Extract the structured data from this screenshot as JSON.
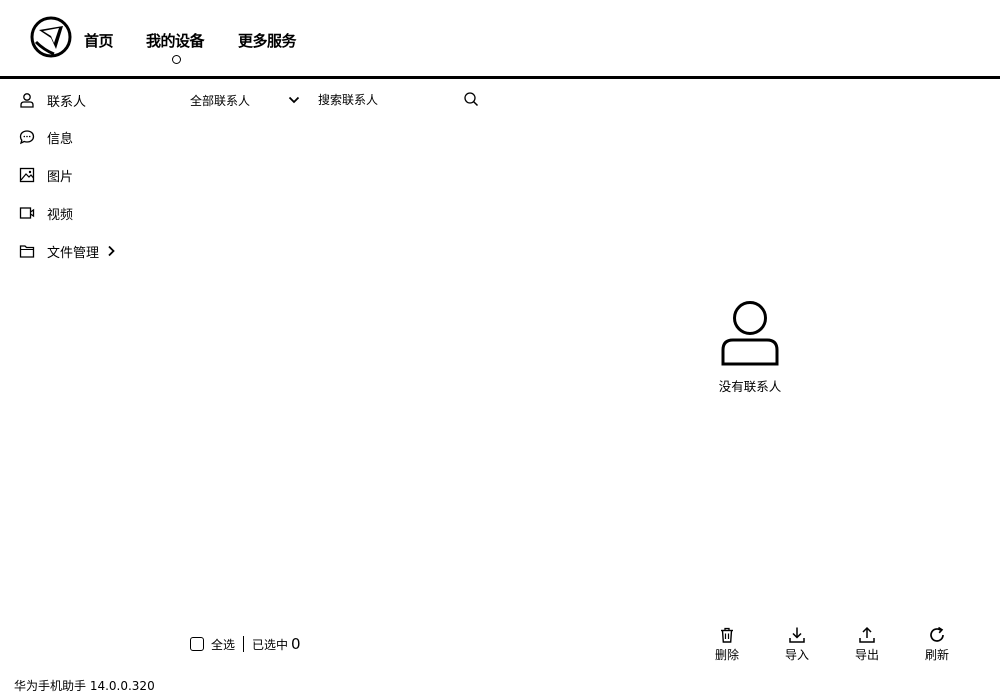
{
  "header": {
    "tabs": [
      {
        "label": "首页"
      },
      {
        "label": "我的设备",
        "active": true
      },
      {
        "label": "更多服务"
      }
    ]
  },
  "sidebar": {
    "items": [
      {
        "label": "联系人",
        "icon": "person-icon"
      },
      {
        "label": "信息",
        "icon": "chat-bubble-icon"
      },
      {
        "label": "图片",
        "icon": "image-icon"
      },
      {
        "label": "视频",
        "icon": "video-icon"
      },
      {
        "label": "文件管理",
        "icon": "folder-icon",
        "has_submenu": true
      }
    ]
  },
  "toolbar": {
    "filter_label": "全部联系人",
    "search_placeholder": "搜索联系人"
  },
  "empty_state": {
    "icon": "person-icon",
    "text": "没有联系人"
  },
  "footer": {
    "select_all_label": "全选",
    "selected_label": "已选中",
    "selected_count": "0",
    "actions": [
      {
        "label": "删除",
        "icon": "trash-icon"
      },
      {
        "label": "导入",
        "icon": "download-icon"
      },
      {
        "label": "导出",
        "icon": "upload-icon"
      },
      {
        "label": "刷新",
        "icon": "refresh-icon"
      }
    ],
    "version": "华为手机助手 14.0.0.320"
  }
}
